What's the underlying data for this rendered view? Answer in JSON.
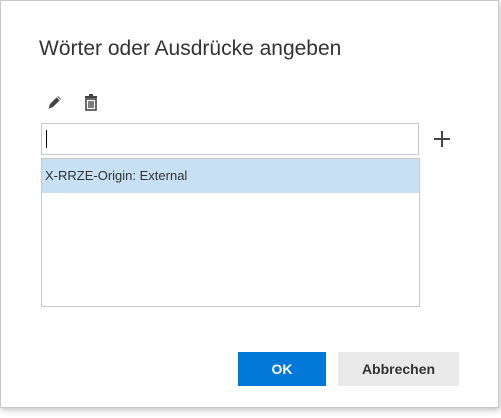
{
  "dialog": {
    "title": "Wörter oder Ausdrücke angeben",
    "toolbar": {
      "edit_icon": "pencil-icon",
      "delete_icon": "trash-icon"
    },
    "input": {
      "value": "",
      "placeholder": ""
    },
    "add_icon": "plus-icon",
    "list": {
      "items": [
        {
          "label": "X-RRZE-Origin: External",
          "selected": true
        }
      ]
    },
    "buttons": {
      "ok_label": "OK",
      "cancel_label": "Abbrechen"
    },
    "colors": {
      "accent": "#0078d7",
      "selection": "#c7e0f4",
      "cancel_bg": "#eaeaea",
      "text": "#333333"
    }
  }
}
